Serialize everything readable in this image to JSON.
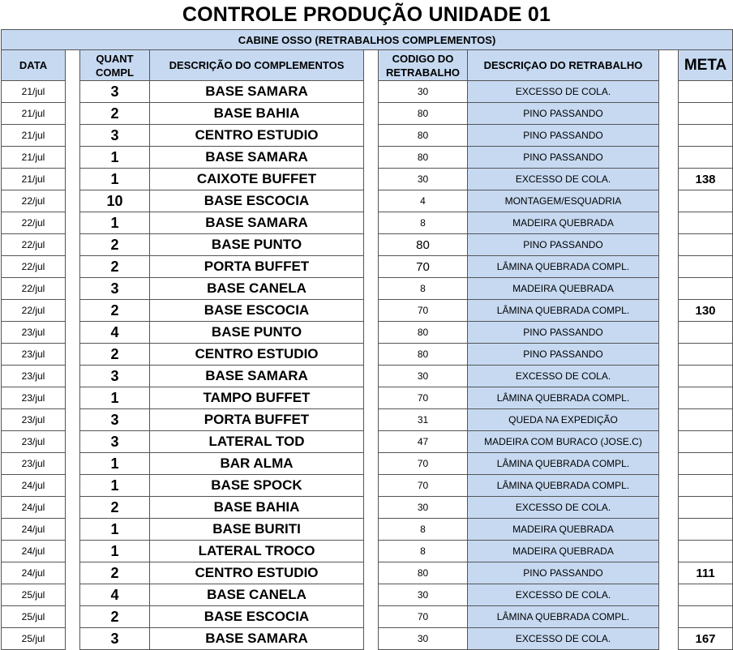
{
  "title": "CONTROLE PRODUÇÃO UNIDADE 01",
  "subtitle": "CABINE OSSO (RETRABALHOS COMPLEMENTOS)",
  "headers": {
    "data": "DATA",
    "quant": "QUANT COMPL",
    "desc": "DESCRIÇÃO DO COMPLEMENTOS",
    "codigo": "CODIGO DO RETRABALHO",
    "retrabalho": "DESCRIÇAO DO RETRABALHO",
    "meta": "META"
  },
  "colors": {
    "header_bg": "#c6d9f1",
    "border": "#555555"
  },
  "rows": [
    {
      "date": "21/jul",
      "qty": "3",
      "desc": "BASE SAMARA",
      "code": "30",
      "ret": "EXCESSO DE COLA.",
      "meta": ""
    },
    {
      "date": "21/jul",
      "qty": "2",
      "desc": "BASE BAHIA",
      "code": "80",
      "ret": "PINO PASSANDO",
      "meta": ""
    },
    {
      "date": "21/jul",
      "qty": "3",
      "desc": "CENTRO ESTUDIO",
      "code": "80",
      "ret": "PINO PASSANDO",
      "meta": ""
    },
    {
      "date": "21/jul",
      "qty": "1",
      "desc": "BASE SAMARA",
      "code": "80",
      "ret": "PINO PASSANDO",
      "meta": ""
    },
    {
      "date": "21/jul",
      "qty": "1",
      "desc": "CAIXOTE BUFFET",
      "code": "30",
      "ret": "EXCESSO DE COLA.",
      "meta": "138"
    },
    {
      "date": "22/jul",
      "qty": "10",
      "desc": "BASE ESCOCIA",
      "code": "4",
      "ret": "MONTAGEM/ESQUADRIA",
      "meta": ""
    },
    {
      "date": "22/jul",
      "qty": "1",
      "desc": "BASE SAMARA",
      "code": "8",
      "ret": "MADEIRA QUEBRADA",
      "meta": ""
    },
    {
      "date": "22/jul",
      "qty": "2",
      "desc": "BASE PUNTO",
      "code": "80",
      "ret": "PINO PASSANDO",
      "meta": "",
      "big": true
    },
    {
      "date": "22/jul",
      "qty": "2",
      "desc": "PORTA BUFFET",
      "code": "70",
      "ret": "LÂMINA QUEBRADA COMPL.",
      "meta": "",
      "big": true
    },
    {
      "date": "22/jul",
      "qty": "3",
      "desc": "BASE CANELA",
      "code": "8",
      "ret": "MADEIRA QUEBRADA",
      "meta": ""
    },
    {
      "date": "22/jul",
      "qty": "2",
      "desc": "BASE ESCOCIA",
      "code": "70",
      "ret": "LÂMINA QUEBRADA COMPL.",
      "meta": "130"
    },
    {
      "date": "23/jul",
      "qty": "4",
      "desc": "BASE PUNTO",
      "code": "80",
      "ret": "PINO PASSANDO",
      "meta": ""
    },
    {
      "date": "23/jul",
      "qty": "2",
      "desc": "CENTRO ESTUDIO",
      "code": "80",
      "ret": "PINO PASSANDO",
      "meta": ""
    },
    {
      "date": "23/jul",
      "qty": "3",
      "desc": "BASE SAMARA",
      "code": "30",
      "ret": "EXCESSO DE COLA.",
      "meta": ""
    },
    {
      "date": "23/jul",
      "qty": "1",
      "desc": "TAMPO BUFFET",
      "code": "70",
      "ret": "LÂMINA QUEBRADA COMPL.",
      "meta": ""
    },
    {
      "date": "23/jul",
      "qty": "3",
      "desc": "PORTA BUFFET",
      "code": "31",
      "ret": "QUEDA NA EXPEDIÇÃO",
      "meta": ""
    },
    {
      "date": "23/jul",
      "qty": "3",
      "desc": "LATERAL TOD",
      "code": "47",
      "ret": "MADEIRA COM BURACO (JOSE.C)",
      "meta": ""
    },
    {
      "date": "23/jul",
      "qty": "1",
      "desc": "BAR ALMA",
      "code": "70",
      "ret": "LÂMINA QUEBRADA COMPL.",
      "meta": ""
    },
    {
      "date": "24/jul",
      "qty": "1",
      "desc": "BASE SPOCK",
      "code": "70",
      "ret": "LÂMINA QUEBRADA COMPL.",
      "meta": ""
    },
    {
      "date": "24/jul",
      "qty": "2",
      "desc": "BASE BAHIA",
      "code": "30",
      "ret": "EXCESSO DE COLA.",
      "meta": ""
    },
    {
      "date": "24/jul",
      "qty": "1",
      "desc": "BASE BURITI",
      "code": "8",
      "ret": "MADEIRA QUEBRADA",
      "meta": ""
    },
    {
      "date": "24/jul",
      "qty": "1",
      "desc": "LATERAL TROCO",
      "code": "8",
      "ret": "MADEIRA QUEBRADA",
      "meta": ""
    },
    {
      "date": "24/jul",
      "qty": "2",
      "desc": "CENTRO ESTUDIO",
      "code": "80",
      "ret": "PINO PASSANDO",
      "meta": "111"
    },
    {
      "date": "25/jul",
      "qty": "4",
      "desc": "BASE CANELA",
      "code": "30",
      "ret": "EXCESSO DE COLA.",
      "meta": ""
    },
    {
      "date": "25/jul",
      "qty": "2",
      "desc": "BASE ESCOCIA",
      "code": "70",
      "ret": "LÂMINA QUEBRADA COMPL.",
      "meta": ""
    },
    {
      "date": "25/jul",
      "qty": "3",
      "desc": "BASE SAMARA",
      "code": "30",
      "ret": "EXCESSO DE COLA.",
      "meta": "167"
    }
  ]
}
